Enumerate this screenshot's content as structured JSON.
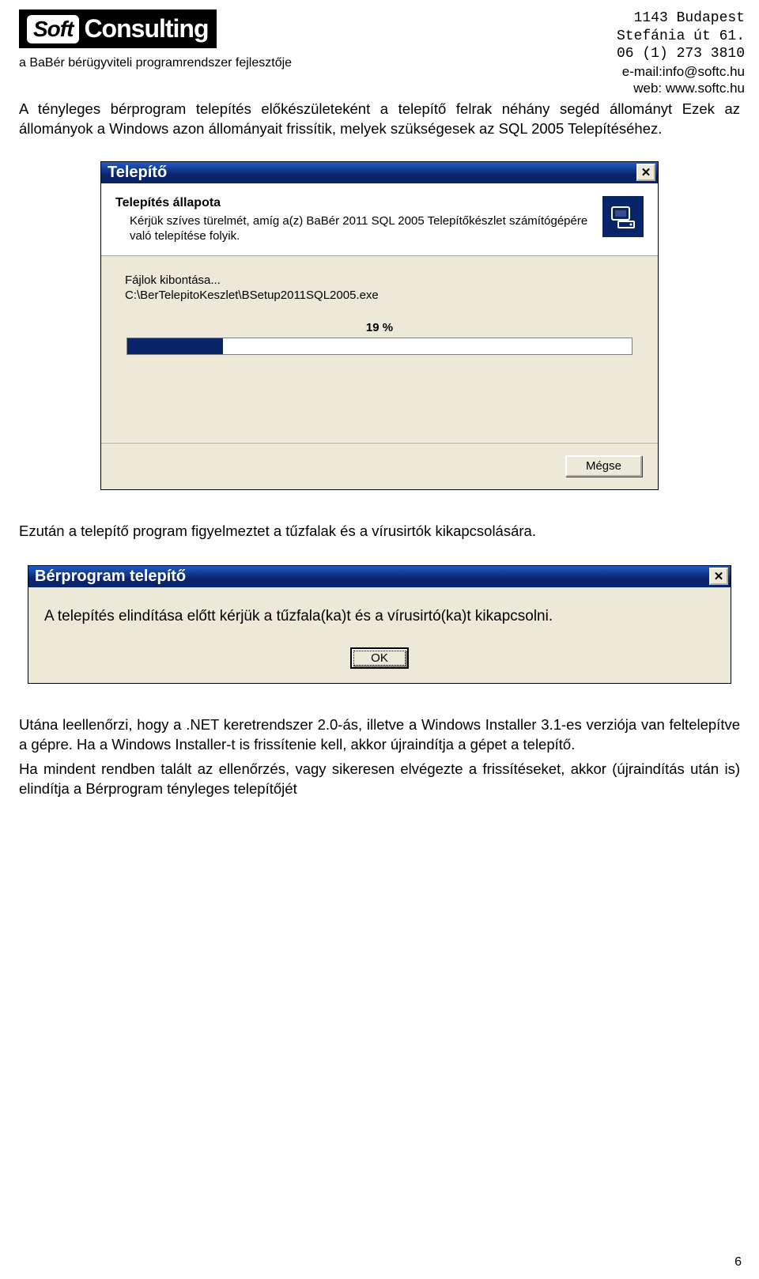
{
  "header": {
    "logo_soft": "Soft",
    "logo_consulting": "Consulting",
    "subtitle": "a BaBér bérügyviteli programrendszer fejlesztője",
    "addr1": "1143 Budapest",
    "addr2": "Stefánia út 61.",
    "addr3": "06 (1) 273 3810",
    "addr4": "e-mail:info@softc.hu",
    "addr5": "web: www.softc.hu"
  },
  "para1": "A tényleges bérprogram telepítés előkészületeként a telepítő felrak néhány segéd állományt Ezek az állományok a Windows azon állományait frissítik, melyek szükségesek az SQL 2005 Telepítéséhez.",
  "dialog1": {
    "title": "Telepítő",
    "status_heading": "Telepítés állapota",
    "status_text": "Kérjük szíves türelmét, amíg a(z) BaBér 2011 SQL 2005 Telepítőkészlet számítógépére való telepítése folyik.",
    "extracting": "Fájlok kibontása...",
    "file_path": "C:\\BerTelepitoKeszlet\\BSetup2011SQL2005.exe",
    "progress_pct_text": "19 %",
    "progress_value": 19,
    "cancel_btn": "Mégse"
  },
  "para2": "Ezután a telepítő program figyelmeztet a tűzfalak és a vírusirtók kikapcsolására.",
  "dialog2": {
    "title": "Bérprogram telepítő",
    "message": "A telepítés elindítása előtt kérjük a tűzfala(ka)t és a vírusirtó(ka)t kikapcsolni.",
    "ok_btn": "OK"
  },
  "para3": "Utána leellenőrzi, hogy a .NET keretrendszer 2.0-ás, illetve a Windows Installer 3.1-es verziója van feltelepítve a gépre. Ha a Windows Installer-t is frissítenie kell, akkor újraindítja a gépet a telepítő.",
  "para4": "Ha mindent rendben talált az ellenőrzés, vagy sikeresen elvégezte a frissítéseket, akkor (újraindítás után is) elindítja a Bérprogram tényleges telepítőjét",
  "page_number": "6"
}
